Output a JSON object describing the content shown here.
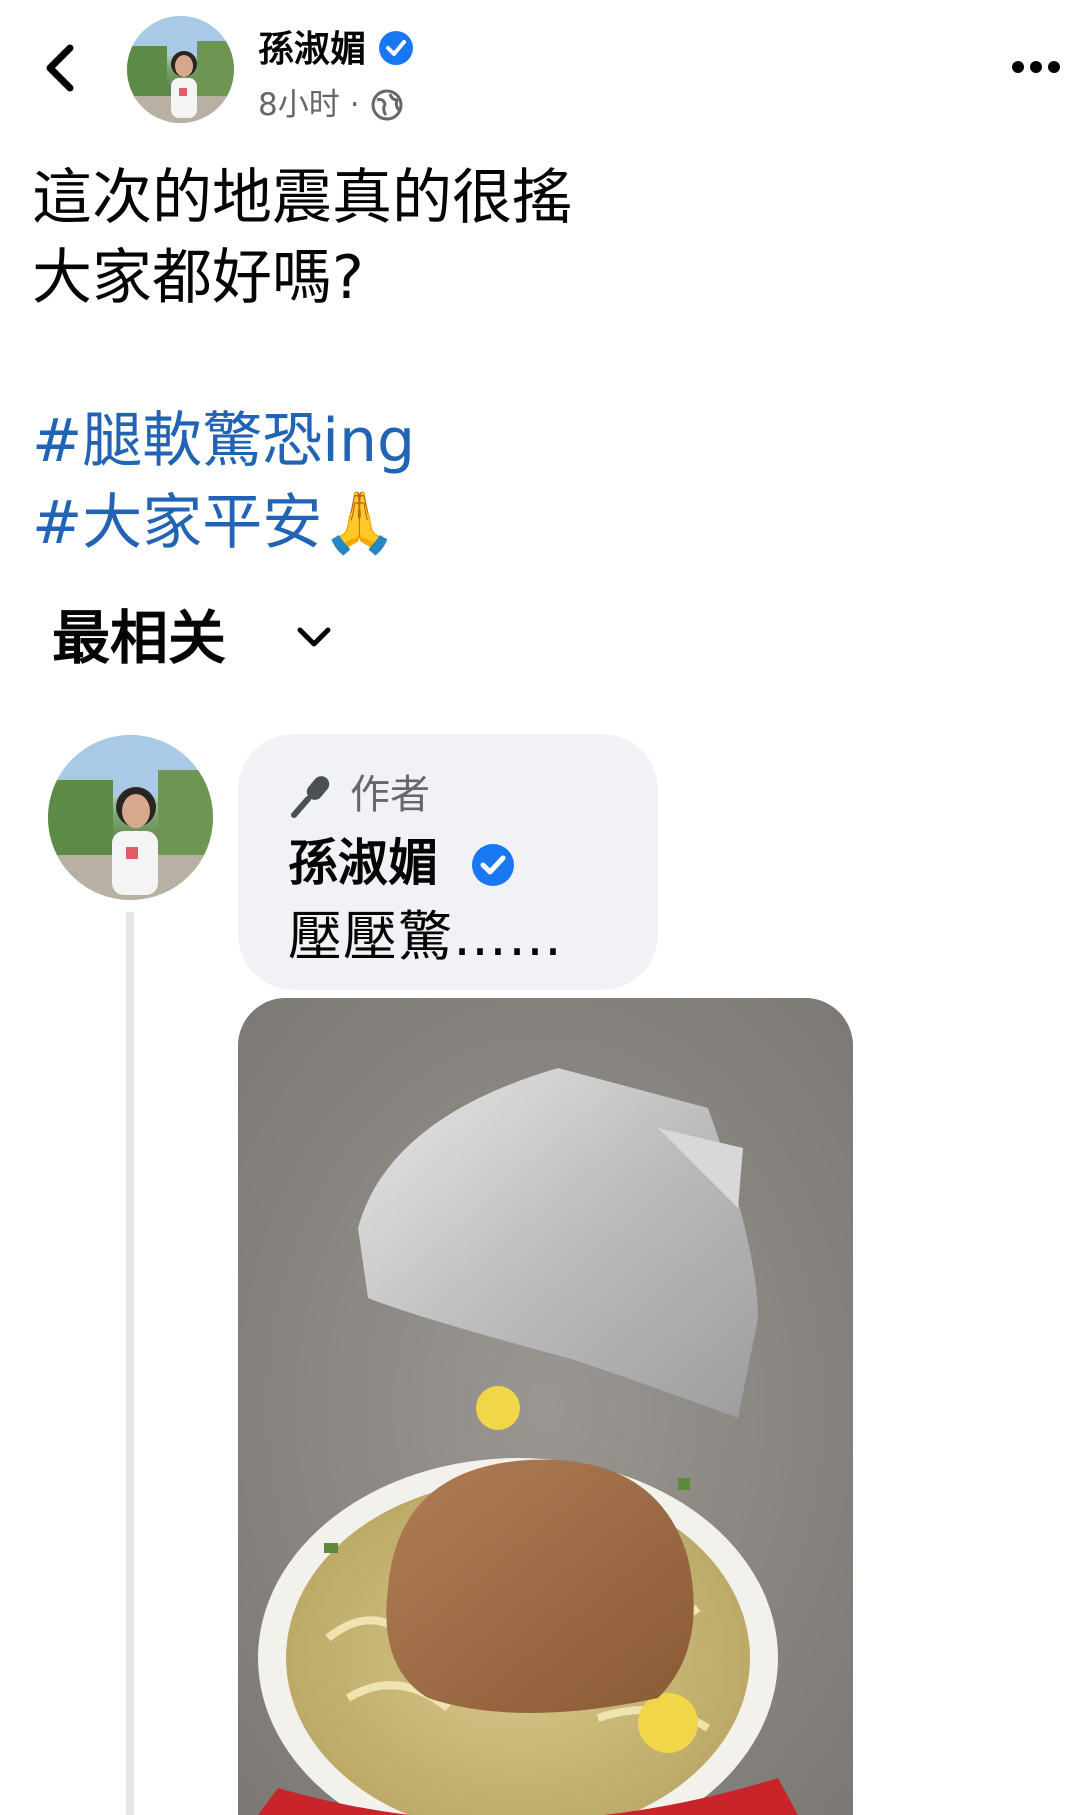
{
  "header": {
    "author_name": "孫淑媚",
    "timestamp": "8小时",
    "separator": "·",
    "privacy_icon": "globe-icon",
    "back_icon": "chevron-left-icon",
    "more_icon": "more-horizontal-icon"
  },
  "post": {
    "lines": [
      "這次的地震真的很搖",
      "大家都好嗎?"
    ],
    "hashtags": [
      "#腿軟驚恐ing",
      "#大家平安🙏"
    ]
  },
  "comments": {
    "sort_label": "最相关",
    "sort_icon": "chevron-down-icon",
    "items": [
      {
        "badge_label": "作者",
        "badge_icon": "microphone-icon",
        "author": "孫淑媚",
        "text": "壓壓驚……",
        "attachment": "photo-instant-noodles"
      }
    ]
  },
  "colors": {
    "verified_blue": "#1877f2",
    "hashtag_blue": "#2163b5",
    "secondary_text": "#65676b",
    "bubble_bg": "#f0f2f5"
  }
}
